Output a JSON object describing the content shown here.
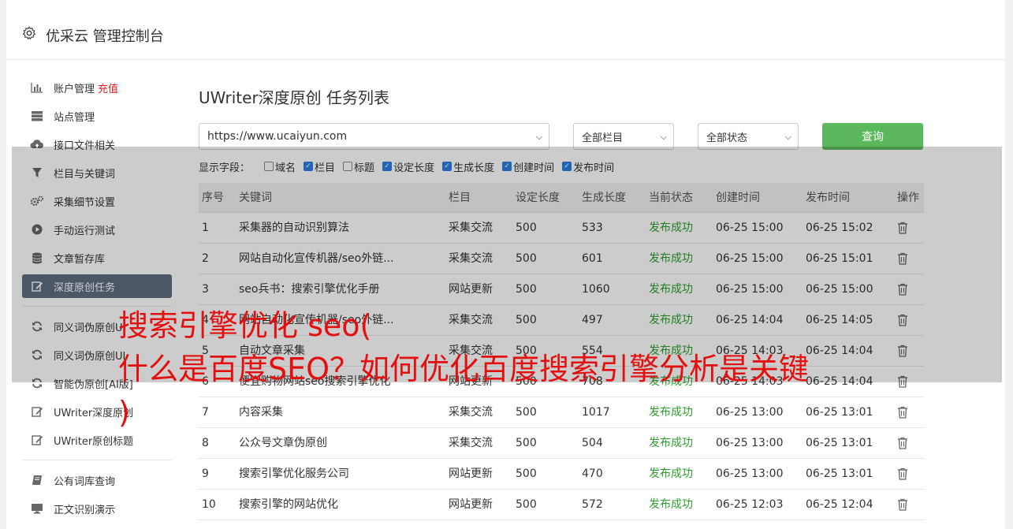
{
  "app": {
    "title": "优采云 管理控制台"
  },
  "sidebar": {
    "items": [
      {
        "label": "账户管理",
        "extra": "充值",
        "icon": "bar-chart-icon"
      },
      {
        "label": "站点管理",
        "icon": "server-icon"
      },
      {
        "label": "接口文件相关",
        "icon": "cloud-upload-icon"
      },
      {
        "label": "栏目与关键词",
        "icon": "filter-icon"
      },
      {
        "label": "采集细节设置",
        "icon": "gears-icon"
      },
      {
        "label": "手动运行测试",
        "icon": "play-circle-icon"
      },
      {
        "label": "文章暂存库",
        "icon": "database-icon"
      },
      {
        "label": "深度原创任务",
        "icon": "edit-icon",
        "active": true
      },
      {
        "label": "同义词伪原创UI",
        "icon": "refresh-icon"
      },
      {
        "label": "同义词伪原创UI",
        "icon": "refresh-icon"
      },
      {
        "label": "智能伪原创[AI版]",
        "icon": "refresh-icon"
      },
      {
        "label": "UWriter深度原创",
        "icon": "edit-icon"
      },
      {
        "label": "UWriter原创标题",
        "icon": "edit-icon"
      },
      {
        "label": "公有词库查询",
        "icon": "book-icon"
      },
      {
        "label": "正文识别演示",
        "icon": "monitor-icon"
      }
    ]
  },
  "main": {
    "title": "UWriter深度原创 任务列表",
    "filters": {
      "site": "https://www.ucaiyun.com",
      "column": "全部栏目",
      "status": "全部状态",
      "query_label": "查询"
    },
    "fields": {
      "label": "显示字段：",
      "options": [
        {
          "label": "域名",
          "checked": false
        },
        {
          "label": "栏目",
          "checked": true
        },
        {
          "label": "标题",
          "checked": false
        },
        {
          "label": "设定长度",
          "checked": true
        },
        {
          "label": "生成长度",
          "checked": true
        },
        {
          "label": "创建时间",
          "checked": true
        },
        {
          "label": "发布时间",
          "checked": true
        }
      ]
    },
    "table": {
      "headers": [
        "序号",
        "关键词",
        "栏目",
        "设定长度",
        "生成长度",
        "当前状态",
        "创建时间",
        "发布时间",
        "操作"
      ],
      "rows": [
        [
          "1",
          "采集器的自动识别算法",
          "采集交流",
          "500",
          "533",
          "发布成功",
          "06-25 15:00",
          "06-25 15:02"
        ],
        [
          "2",
          "网站自动化宣传机器/seo外链...",
          "采集交流",
          "500",
          "601",
          "发布成功",
          "06-25 15:00",
          "06-25 15:01"
        ],
        [
          "3",
          "seo兵书：搜索引擎优化手册",
          "网站更新",
          "500",
          "1060",
          "发布成功",
          "06-25 15:00",
          "06-25 15:00"
        ],
        [
          "4",
          "网站自动化宣传机器/seo外链...",
          "采集交流",
          "500",
          "497",
          "发布成功",
          "06-25 14:04",
          "06-25 14:05"
        ],
        [
          "5",
          "自动文章采集",
          "采集交流",
          "500",
          "554",
          "发布成功",
          "06-25 14:03",
          "06-25 14:04"
        ],
        [
          "6",
          "便宜购物网站seo搜索引擎优化",
          "网站更新",
          "500",
          "708",
          "发布成功",
          "06-25 14:03",
          "06-25 14:04"
        ],
        [
          "7",
          "内容采集",
          "采集交流",
          "500",
          "1017",
          "发布成功",
          "06-25 13:00",
          "06-25 13:01"
        ],
        [
          "8",
          "公众号文章伪原创",
          "采集交流",
          "500",
          "504",
          "发布成功",
          "06-25 13:00",
          "06-25 13:01"
        ],
        [
          "9",
          "搜索引擎优化服务公司",
          "网站更新",
          "500",
          "470",
          "发布成功",
          "06-25 13:00",
          "06-25 13:01"
        ],
        [
          "10",
          "搜索引擎的网站优化",
          "网站更新",
          "500",
          "572",
          "发布成功",
          "06-25 12:03",
          "06-25 12:04"
        ]
      ]
    }
  },
  "overlay": {
    "line1": "搜索引擎优化 seo(",
    "line2": "什么是百度SEO？如何优化百度搜索引擎分析是关键",
    "line3": ")"
  },
  "colors": {
    "accent": "#5cb85c",
    "active_nav": "#5f6d7f",
    "success": "#2e9e2e",
    "overlay_text": "#e41010"
  }
}
